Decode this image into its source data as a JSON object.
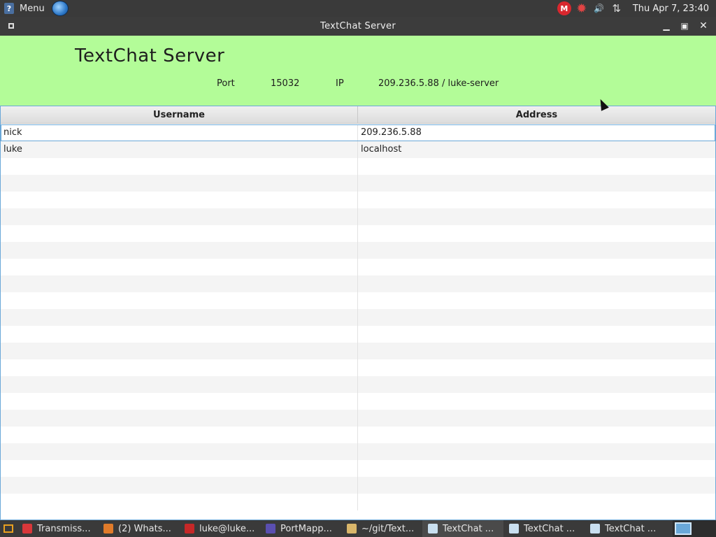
{
  "top_panel": {
    "menu_label": "Menu",
    "mega_icon": "M",
    "clock": "Thu Apr  7, 23:40"
  },
  "window": {
    "title": "TextChat Server"
  },
  "app": {
    "title": "TextChat Server",
    "port_label": "Port",
    "port_value": "15032",
    "ip_label": "IP",
    "ip_value": "209.236.5.88 / luke-server"
  },
  "table": {
    "columns": [
      "Username",
      "Address"
    ],
    "rows": [
      {
        "username": "nick",
        "address": "209.236.5.88"
      },
      {
        "username": "luke",
        "address": "localhost"
      }
    ],
    "empty_rows": 21
  },
  "taskbar": {
    "items": [
      {
        "label": "Transmiss...",
        "icon": "transmission-icon",
        "color": "#d8373a"
      },
      {
        "label": "(2) Whats...",
        "icon": "firefox-icon",
        "color": "#e07b2a"
      },
      {
        "label": "luke@luke...",
        "icon": "terminal-icon",
        "color": "#c62828"
      },
      {
        "label": "PortMapp...",
        "icon": "portmapper-icon",
        "color": "#5a4fb0"
      },
      {
        "label": "~/git/Text...",
        "icon": "editor-icon",
        "color": "#d9b66a"
      },
      {
        "label": "TextChat ...",
        "icon": "window-icon",
        "color": "#c9dff0",
        "active": true
      },
      {
        "label": "TextChat ...",
        "icon": "window-icon",
        "color": "#c9dff0"
      },
      {
        "label": "TextChat ...",
        "icon": "window-icon",
        "color": "#c9dff0"
      }
    ]
  },
  "colors": {
    "header_bg": "#b3fc98",
    "selection_border": "#6aa8d8"
  }
}
